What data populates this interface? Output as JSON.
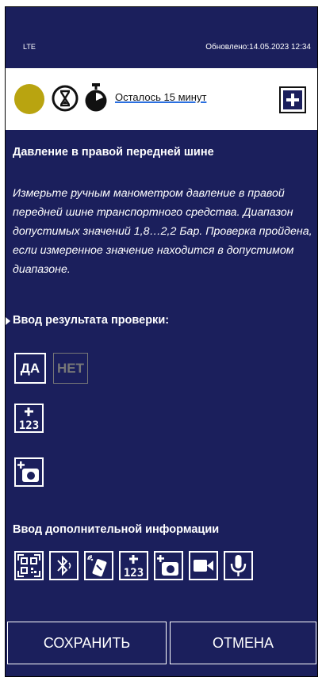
{
  "status_bar": {
    "network": "LTE",
    "updated": "Обновлено:14.05.2023 12:34"
  },
  "top_bar": {
    "time_left": "Осталось 15 минут",
    "status_dot_color": "#b9a410",
    "icons": [
      "status-dot",
      "hourglass-icon",
      "stopwatch-icon",
      "add-note-icon"
    ]
  },
  "check": {
    "title": "Давление в правой передней шине",
    "description": "Измерьте ручным манометром давление в правой передней шине транспортного средства. Диапазон допустимых значений 1,8…2,2 Бар. Проверка пройдена, если измеренное значение находится в допустимом диапазоне."
  },
  "result_input": {
    "heading": "Ввод результата проверки:",
    "yes_label": "ДА",
    "no_label": "НЕТ",
    "icons": [
      "add-number-icon",
      "add-photo-icon"
    ]
  },
  "additional_info": {
    "heading": "Ввод дополнительной информации",
    "icons": [
      "qr-code-icon",
      "bluetooth-icon",
      "nfc-icon",
      "add-number-icon",
      "add-photo-icon",
      "video-icon",
      "microphone-icon"
    ]
  },
  "actions": {
    "save_label": "СОХРАНИТЬ",
    "cancel_label": "ОТМЕНА"
  },
  "colors": {
    "background": "#1b1f5c",
    "top_bar": "#ffffff",
    "accent_underline": "#2a6fe0",
    "disabled": "#777777"
  }
}
